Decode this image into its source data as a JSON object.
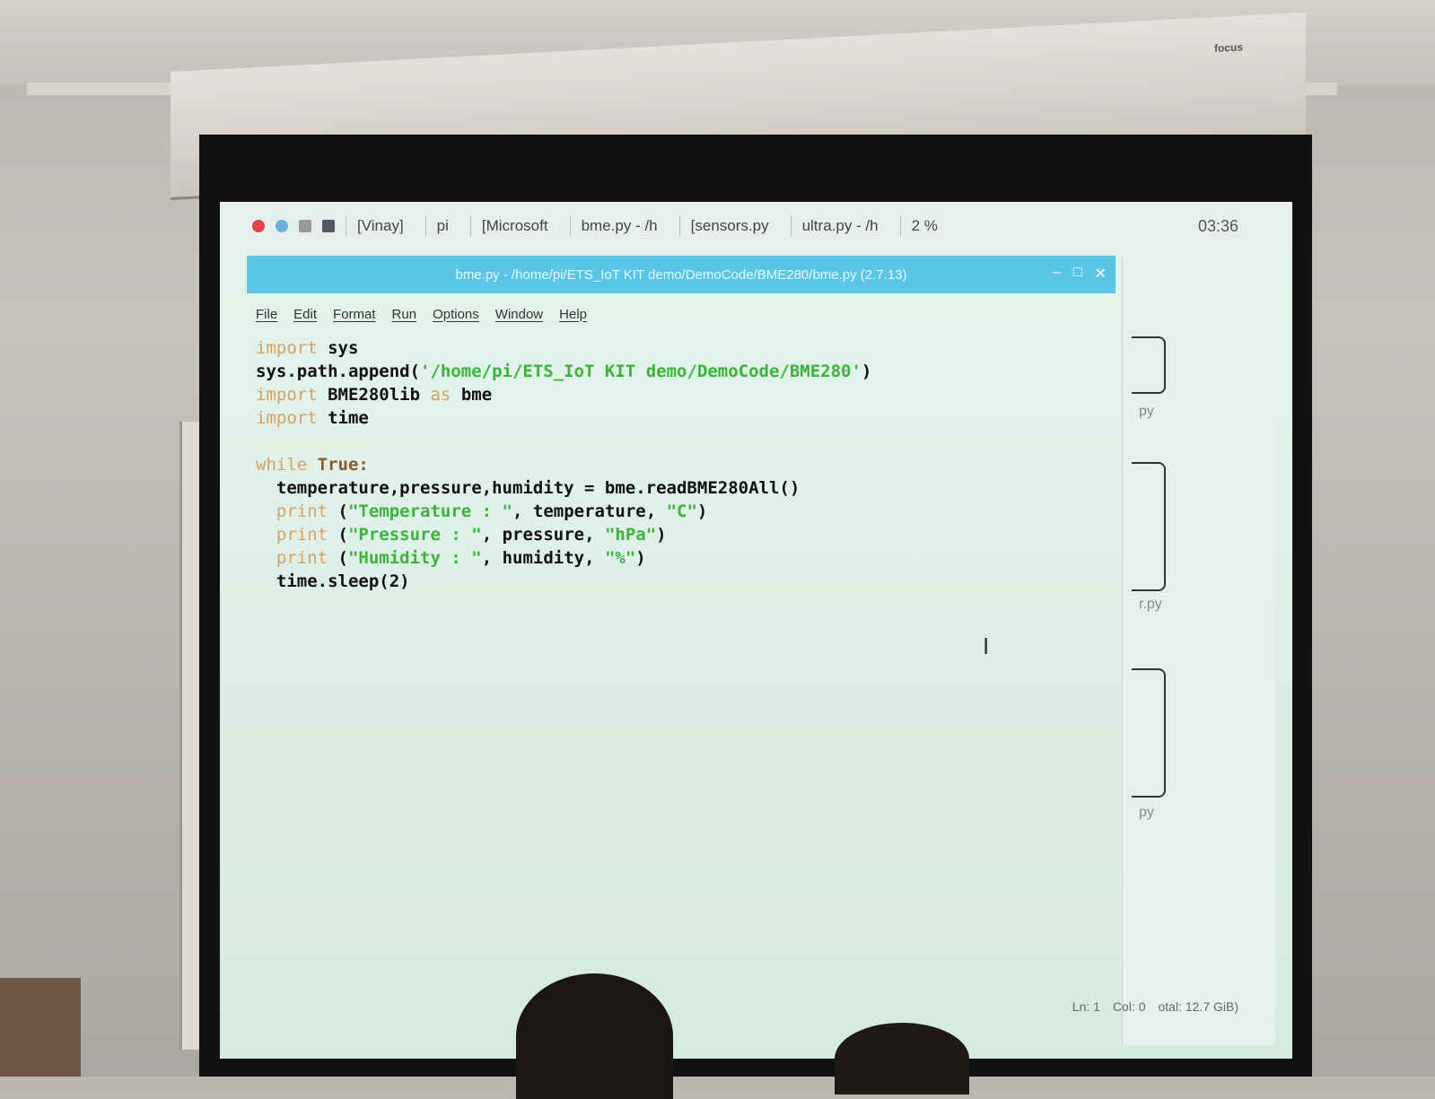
{
  "taskbar": {
    "items": [
      "[Vinay]",
      "pi",
      "[Microsoft",
      "bme.py - /h",
      "[sensors.py",
      "ultra.py - /h"
    ],
    "battery": "2 %",
    "clock": "03:36"
  },
  "projector_brand": "focus",
  "window": {
    "title": "bme.py - /home/pi/ETS_IoT KIT demo/DemoCode/BME280/bme.py (2.7.13)",
    "menu": [
      "File",
      "Edit",
      "Format",
      "Run",
      "Options",
      "Window",
      "Help"
    ]
  },
  "code": {
    "l1_kw": "import",
    "l1_rest": " sys",
    "l2_pre": "sys.path.append(",
    "l2_str": "'/home/pi/ETS_IoT KIT demo/DemoCode/BME280'",
    "l2_post": ")",
    "l3_kw": "import",
    "l3_rest": " BME280lib ",
    "l3_kw2": "as",
    "l3_rest2": " bme",
    "l4_kw": "import",
    "l4_rest": " time",
    "l6_kw": "while",
    "l6_rest": " True:",
    "l7": "  temperature,pressure,humidity = bme.readBME280All()",
    "l8_kw": "  print",
    "l8_pre": " (",
    "l8_str": "\"Temperature : \"",
    "l8_mid": ", temperature, ",
    "l8_str2": "\"C\"",
    "l8_post": ")",
    "l9_kw": "  print",
    "l9_pre": " (",
    "l9_str": "\"Pressure : \"",
    "l9_mid": ", pressure, ",
    "l9_str2": "\"hPa\"",
    "l9_post": ")",
    "l10_kw": "  print",
    "l10_pre": " (",
    "l10_str": "\"Humidity : \"",
    "l10_mid": ", humidity, ",
    "l10_str2": "\"%\"",
    "l10_post": ")",
    "l11": "  time.sleep(2)"
  },
  "side": {
    "label1": "py",
    "label2": "r.py",
    "label3": "py"
  },
  "status": {
    "ln": "Ln: 1",
    "col": "Col: 0",
    "disk": "otal: 12.7 GiB)"
  },
  "colors": {
    "keyword": "#d7a060",
    "string": "#3bb43b",
    "titlebar": "#59c6e8"
  }
}
